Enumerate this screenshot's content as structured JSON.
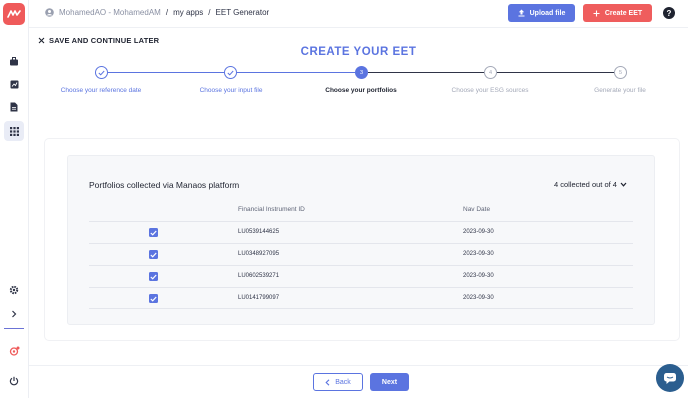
{
  "breadcrumb": {
    "user": "MohamedAO - MohamedAM",
    "sep1": "/",
    "apps": "my apps",
    "sep2": "/",
    "current": "EET Generator"
  },
  "header": {
    "upload_label": "Upload file",
    "create_label": "Create EET",
    "help_label": "?"
  },
  "save_later_label": "SAVE AND CONTINUE LATER",
  "page_title": "CREATE YOUR EET",
  "steps": [
    {
      "number": "1",
      "label": "Choose your reference date",
      "state": "done"
    },
    {
      "number": "2",
      "label": "Choose your input file",
      "state": "done"
    },
    {
      "number": "3",
      "label": "Choose your portfolios",
      "state": "current"
    },
    {
      "number": "4",
      "label": "Choose your ESG sources",
      "state": "todo"
    },
    {
      "number": "5",
      "label": "Generate your file",
      "state": "todo"
    }
  ],
  "portfolios": {
    "title": "Portfolios collected via Manaos platform",
    "collected_label": "4 collected out of 4",
    "columns": {
      "fid": "Financial Instrument ID",
      "nav_date": "Nav Date"
    },
    "rows": [
      {
        "checked": true,
        "fid": "LU0539144625",
        "nav_date": "2023-09-30"
      },
      {
        "checked": true,
        "fid": "LU0348927095",
        "nav_date": "2023-09-30"
      },
      {
        "checked": true,
        "fid": "LU0602539271",
        "nav_date": "2023-09-30"
      },
      {
        "checked": true,
        "fid": "LU0141799097",
        "nav_date": "2023-09-30"
      }
    ]
  },
  "footer": {
    "back_label": "Back",
    "next_label": "Next"
  },
  "colors": {
    "primary": "#5b74e0",
    "danger": "#ef5d5d",
    "brand": "#ef5a5a",
    "chat": "#2b5e8f"
  },
  "icons": [
    "logo-icon",
    "briefcase-icon",
    "chart-icon",
    "document-icon",
    "apps-grid-icon",
    "gear-icon",
    "chevron-right-icon",
    "notification-icon",
    "power-icon",
    "user-circle-icon",
    "upload-icon",
    "plus-icon",
    "close-icon",
    "check-icon",
    "chevron-down-icon",
    "chevron-left-icon",
    "chat-icon"
  ]
}
